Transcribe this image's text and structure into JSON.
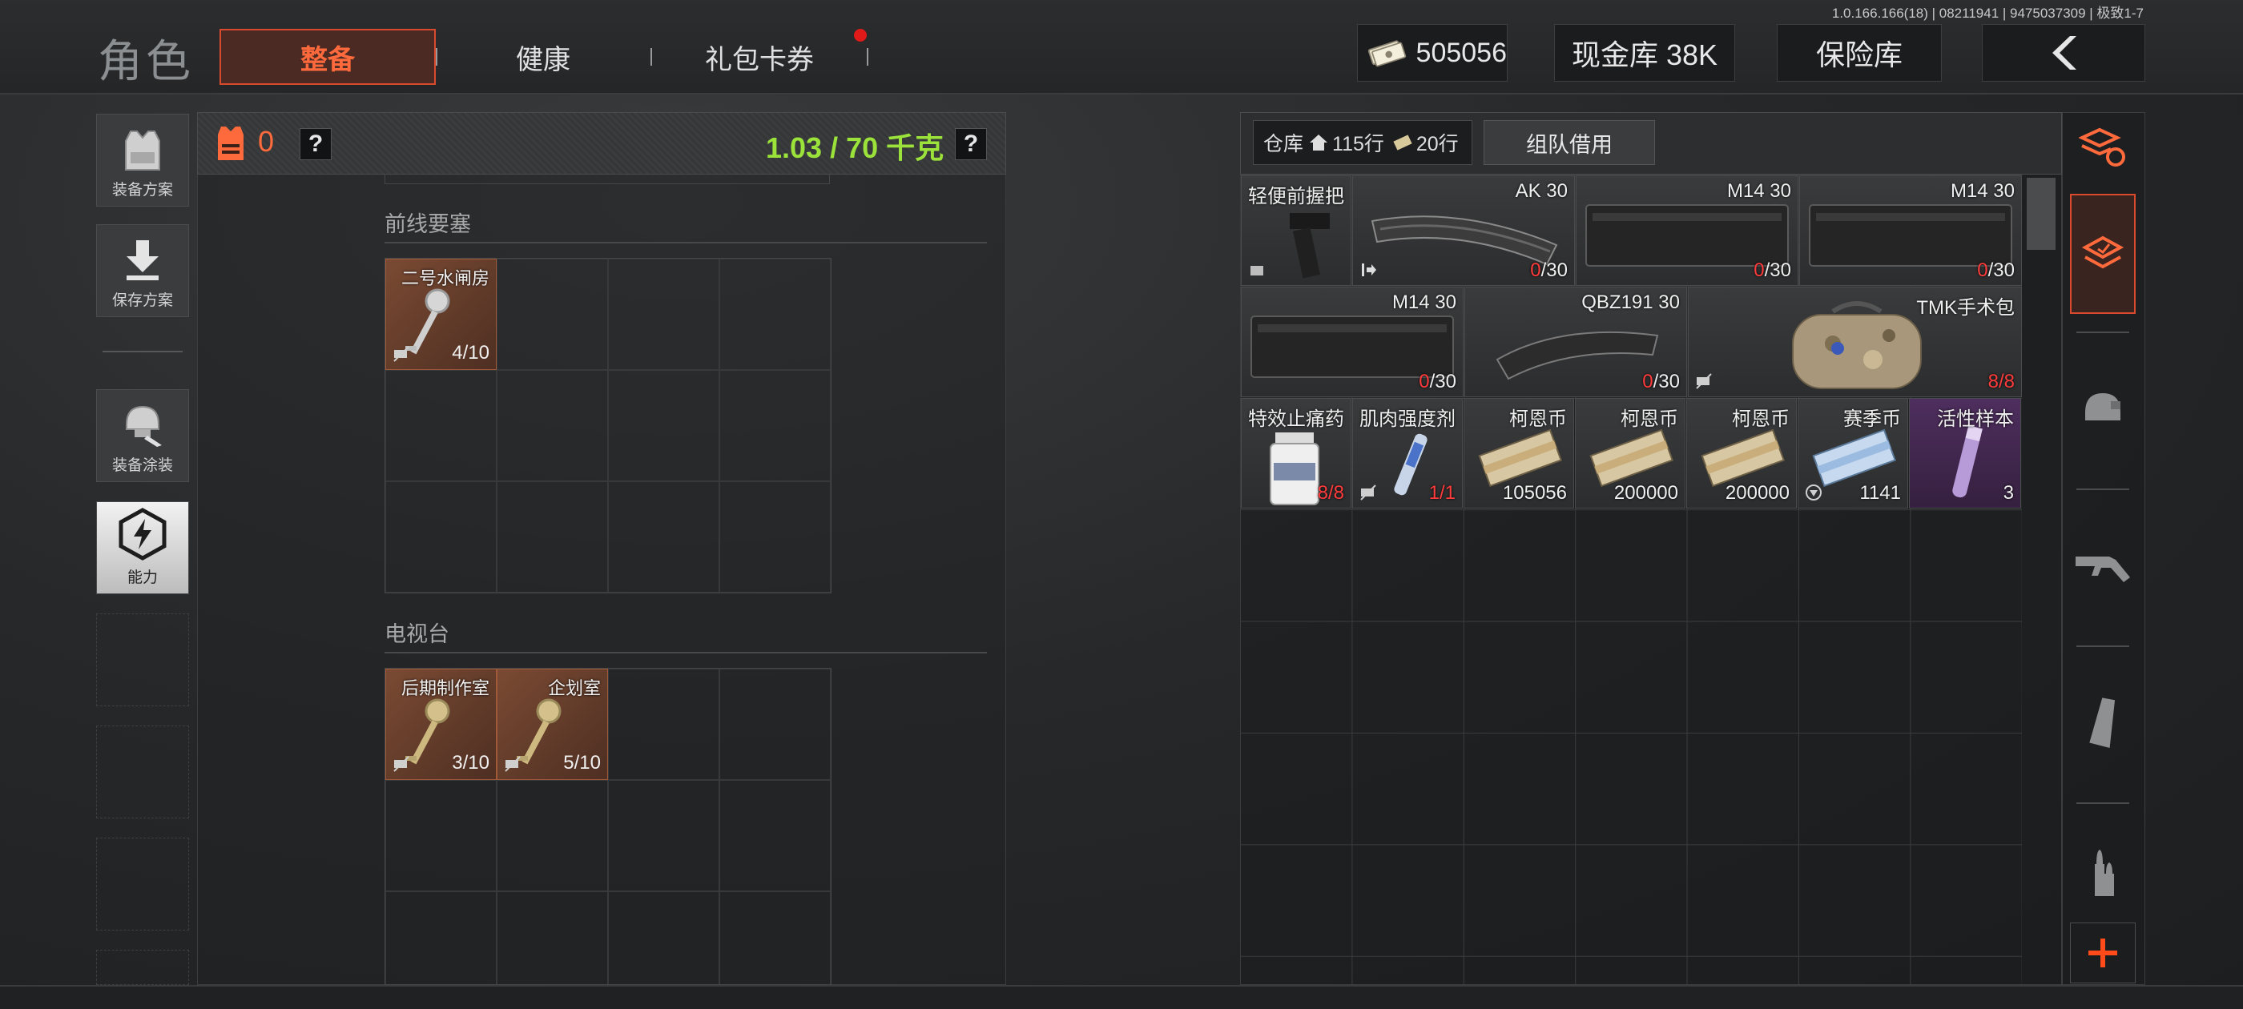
{
  "header": {
    "brand": "角色",
    "tabs": [
      {
        "label": "整备",
        "active": true
      },
      {
        "label": "健康",
        "active": false
      },
      {
        "label": "礼包卡券",
        "active": false
      }
    ],
    "version": "1.0.166.166(18) | 08211941 | 9475037309 | 极致1-7",
    "money": "505056",
    "cash_vault": "现金库 38K",
    "insurance": "保险库",
    "back_icon": "chevron-left-icon",
    "accent": "#ff6a3d",
    "notice_color": "#e01919"
  },
  "sidebar": {
    "items": [
      {
        "label": "装备方案",
        "icon": "vest-icon"
      },
      {
        "label": "保存方案",
        "icon": "download-icon"
      },
      {
        "label": "装备涂装",
        "icon": "helmet-paint-icon"
      },
      {
        "label": "能力",
        "icon": "ability-hex-icon",
        "active": true
      }
    ]
  },
  "loadout": {
    "armor_count": "0",
    "help": "?",
    "weight": "1.03 / 70 千克",
    "weight_color": "#9be33a",
    "sections": [
      {
        "title": "前线要塞",
        "items": [
          {
            "name": "二号水闸房",
            "count": "4/10"
          }
        ]
      },
      {
        "title": "电视台",
        "items": [
          {
            "name": "后期制作室",
            "count": "3/10"
          },
          {
            "name": "企划室",
            "count": "5/10"
          }
        ]
      }
    ]
  },
  "storage": {
    "label": "仓库",
    "rows_main": "115行",
    "rows_extra": "20行",
    "team_borrow": "组队借用",
    "items": [
      {
        "name": "轻便前握把",
        "count": ""
      },
      {
        "name": "AK 30",
        "count_red": "0",
        "count_rest": "/30"
      },
      {
        "name": "M14 30",
        "count_red": "0",
        "count_rest": "/30"
      },
      {
        "name": "M14 30",
        "count_red": "0",
        "count_rest": "/30"
      },
      {
        "name": "M14 30",
        "count_red": "0",
        "count_rest": "/30"
      },
      {
        "name": "QBZ191 30",
        "count_red": "0",
        "count_rest": "/30"
      },
      {
        "name": "TMK手术包",
        "count_red": "8/8",
        "count_rest": ""
      },
      {
        "name": "特效止痛药",
        "count_red": "8/8",
        "count_rest": ""
      },
      {
        "name": "肌肉强度剂",
        "count_red": "1/1",
        "count_rest": ""
      },
      {
        "name": "柯恩币",
        "count": "105056"
      },
      {
        "name": "柯恩币",
        "count": "200000"
      },
      {
        "name": "柯恩币",
        "count": "200000"
      },
      {
        "name": "赛季币",
        "count": "1141"
      },
      {
        "name": "活性样本",
        "count": "3"
      }
    ]
  },
  "rail": {
    "icons": [
      "stack-refresh-icon",
      "storage-icon",
      "helmet-icon",
      "rifle-icon",
      "magazine-icon",
      "ammo-icon",
      "plus-icon"
    ]
  }
}
